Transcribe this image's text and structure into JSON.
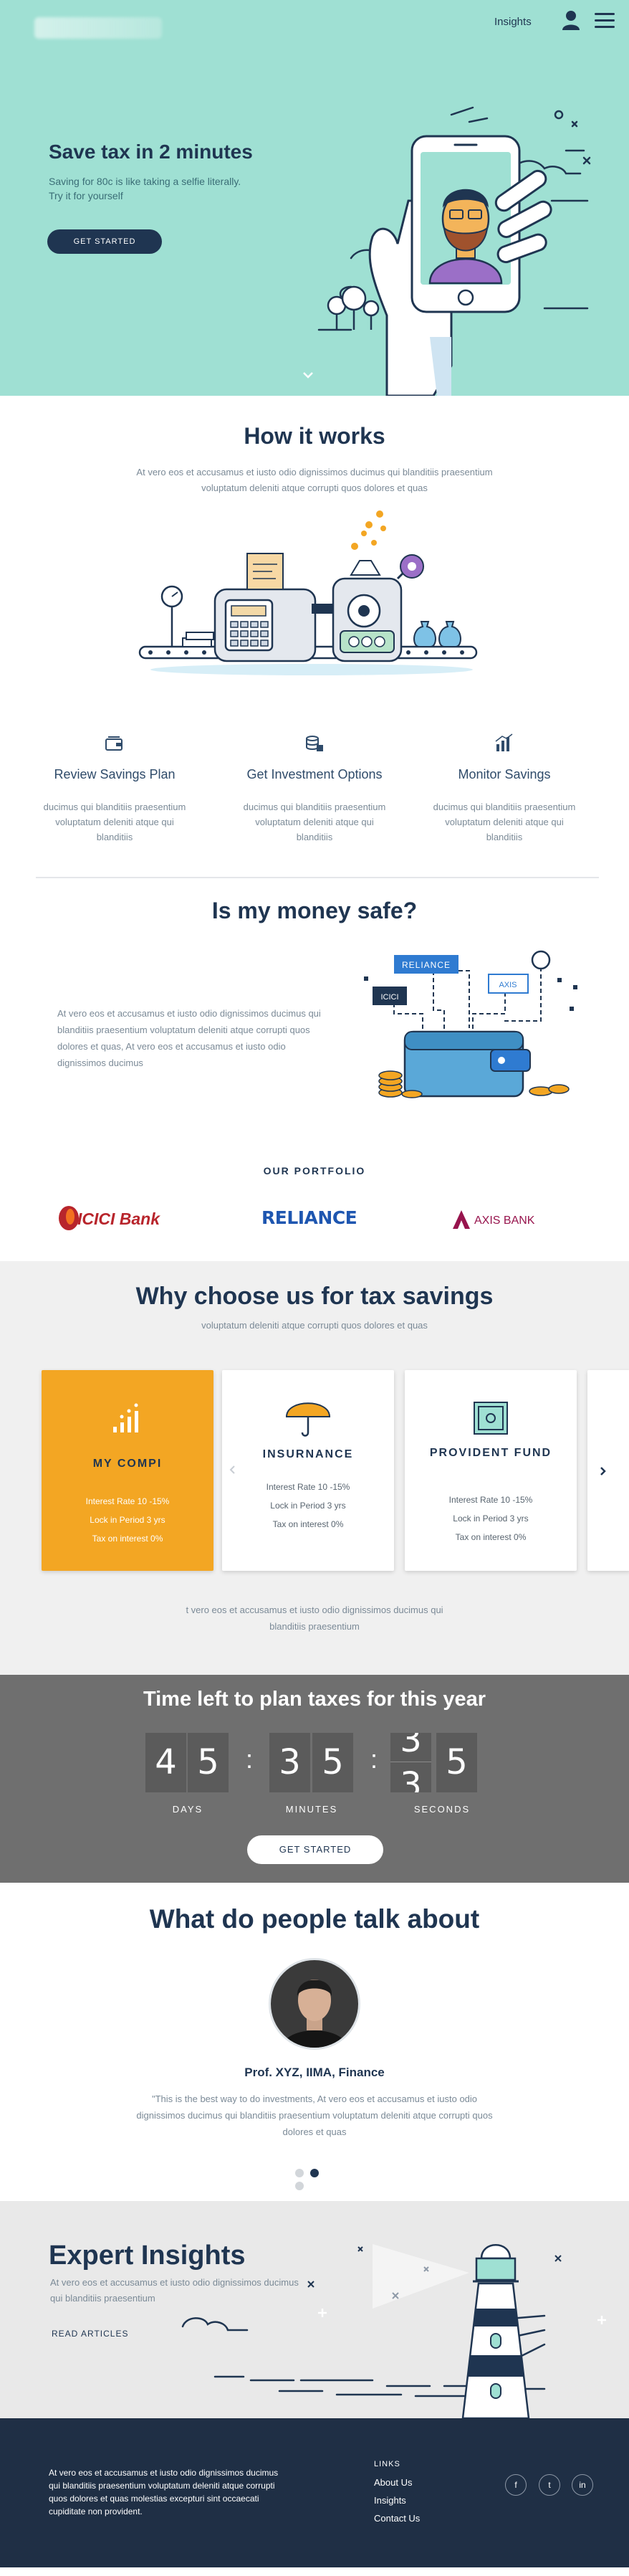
{
  "nav": {
    "insights_label": "Insights"
  },
  "hero": {
    "title": "Save tax in 2 minutes",
    "subtitle": "Saving for 80c is like taking a selfie literally. Try it for yourself",
    "cta": "GET STARTED"
  },
  "how": {
    "title": "How it works",
    "text": "At vero eos et accusamus et iusto odio dignissimos ducimus qui blanditiis praesentium voluptatum deleniti atque corrupti quos dolores et quas",
    "steps": [
      {
        "title": "Review Savings Plan",
        "text": "ducimus qui blanditiis praesentium voluptatum deleniti atque qui blanditiis"
      },
      {
        "title": "Get Investment Options",
        "text": "ducimus qui blanditiis praesentium voluptatum deleniti atque qui blanditiis"
      },
      {
        "title": "Monitor Savings",
        "text": "ducimus qui blanditiis praesentium voluptatum deleniti atque qui blanditiis"
      }
    ]
  },
  "safe": {
    "title": "Is my money safe?",
    "text": "At vero eos et accusamus et iusto odio dignissimos ducimus qui blanditiis praesentium voluptatum deleniti atque corrupti quos dolores et quas, At vero eos et accusamus et iusto odio dignissimos ducimus",
    "tag_reliance": "RELIANCE",
    "tag_icici": "ICICI",
    "tag_axis": "AXIS",
    "portfolio_label": "OUR PORTFOLIO",
    "logo_icici": "ICICI Bank",
    "logo_reliance": "RELIANCE",
    "logo_axis": "AXIS BANK"
  },
  "why": {
    "title": "Why choose us for tax savings",
    "subtitle": "voluptatum deleniti atque corrupti quos dolores et quas",
    "cards": [
      {
        "title": "MY COMPI",
        "lines": [
          "Interest Rate  10 -15%",
          "Lock in Period  3 yrs",
          "Tax on interest  0%"
        ]
      },
      {
        "title": "INSURNANCE",
        "lines": [
          "Interest Rate  10 -15%",
          "Lock in Period  3 yrs",
          "Tax on interest  0%"
        ]
      },
      {
        "title": "PROVIDENT FUND",
        "lines": [
          "Interest Rate  10 -15%",
          "Lock in Period  3 yrs",
          "Tax on interest  0%"
        ]
      }
    ],
    "text": "t vero eos et accusamus et iusto odio dignissimos ducimus qui blanditiis praesentium"
  },
  "countdown": {
    "title": "Time left to plan taxes for this year",
    "days": [
      "4",
      "5"
    ],
    "minutes": [
      "3",
      "5"
    ],
    "seconds": [
      "3",
      "5"
    ],
    "seconds_split_top": "3",
    "seconds_split_bottom": "3",
    "days_label": "DAYS",
    "minutes_label": "MINUTES",
    "seconds_label": "SECONDS",
    "cta": "GET STARTED"
  },
  "testimonial": {
    "title": "What do people talk about",
    "name": "Prof. XYZ, IIMA, Finance",
    "quote": "\"This is the best way to do investments, At vero eos et accusamus et iusto odio dignissimos ducimus qui blanditiis praesentium voluptatum deleniti atque corrupti quos dolores et quas"
  },
  "insights": {
    "title": "Expert  Insights",
    "text": "At vero eos et accusamus et iusto odio dignissimos ducimus qui blanditiis praesentium",
    "link": "READ ARTICLES"
  },
  "footer": {
    "text": "At vero eos et accusamus et iusto odio dignissimos ducimus qui blanditiis praesentium voluptatum deleniti atque corrupti quos dolores et quas molestias excepturi sint occaecati cupiditate non provident.",
    "links_title": "LINKS",
    "links": [
      "About Us",
      "Insights",
      "Contact Us"
    ],
    "social": [
      "f",
      "t",
      "in"
    ]
  },
  "colors": {
    "hero_bg": "#9fe0d3",
    "navy": "#1f3551",
    "accent_orange": "#f3a623",
    "countdown_bg": "#6f6f6f",
    "footer_bg": "#1f2f45"
  }
}
